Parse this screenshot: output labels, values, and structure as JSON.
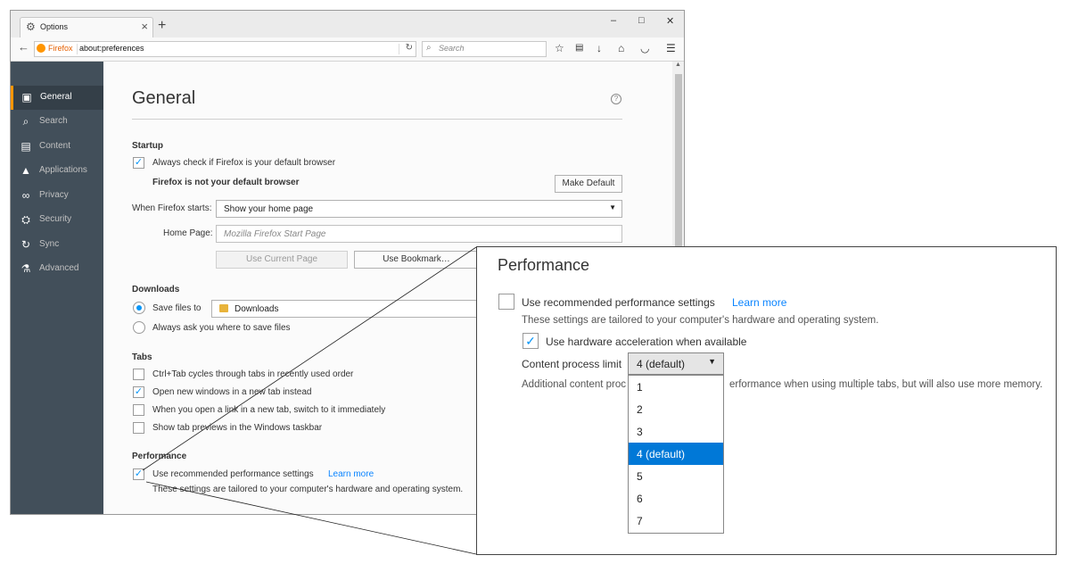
{
  "tab": {
    "title": "Options",
    "icon": "gear-icon"
  },
  "window_controls": [
    "–",
    "□",
    "✕"
  ],
  "navbar": {
    "brand": "Firefox",
    "url": "about:preferences",
    "search_placeholder": "Search"
  },
  "sidebar": {
    "items": [
      {
        "label": "General",
        "icon": "general-icon",
        "active": true
      },
      {
        "label": "Search",
        "icon": "search-icon",
        "active": false
      },
      {
        "label": "Content",
        "icon": "content-icon",
        "active": false
      },
      {
        "label": "Applications",
        "icon": "applications-icon",
        "active": false
      },
      {
        "label": "Privacy",
        "icon": "privacy-mask-icon",
        "active": false
      },
      {
        "label": "Security",
        "icon": "security-icon",
        "active": false
      },
      {
        "label": "Sync",
        "icon": "sync-icon",
        "active": false
      },
      {
        "label": "Advanced",
        "icon": "advanced-icon",
        "active": false
      }
    ]
  },
  "main": {
    "title": "General",
    "startup": {
      "heading": "Startup",
      "default_check_label": "Always check if Firefox is your default browser",
      "default_checked": true,
      "not_default_text": "Firefox is not your default browser",
      "make_default_button": "Make Default",
      "when_starts_label": "When Firefox starts:",
      "when_starts_value": "Show your home page",
      "home_page_label": "Home Page:",
      "home_page_placeholder": "Mozilla Firefox Start Page",
      "use_current_button": "Use Current Page",
      "use_bookmark_button": "Use Bookmark…"
    },
    "downloads": {
      "heading": "Downloads",
      "save_to_label": "Save files to",
      "save_to_folder": "Downloads",
      "always_ask_label": "Always ask you where to save files"
    },
    "tabs": {
      "heading": "Tabs",
      "options": [
        {
          "label": "Ctrl+Tab cycles through tabs in recently used order",
          "checked": false
        },
        {
          "label": "Open new windows in a new tab instead",
          "checked": true
        },
        {
          "label": "When you open a link in a new tab, switch to it immediately",
          "checked": false
        },
        {
          "label": "Show tab previews in the Windows taskbar",
          "checked": false
        }
      ]
    },
    "performance": {
      "heading": "Performance",
      "recommended_label": "Use recommended performance settings",
      "recommended_checked": true,
      "learn_more": "Learn more",
      "description": "These settings are tailored to your computer's hardware and operating system."
    }
  },
  "zoom_panel": {
    "title": "Performance",
    "recommended_label": "Use recommended performance settings",
    "recommended_checked": false,
    "learn_more": "Learn more",
    "description": "These settings are tailored to your computer's hardware and operating system.",
    "hw_accel_label": "Use hardware acceleration when available",
    "hw_accel_checked": true,
    "process_limit_label": "Content process limit",
    "process_limit_value": "4 (default)",
    "additional_text_left": "Additional content proc",
    "additional_text_right": "erformance when using multiple tabs, but will also use more memory.",
    "options": [
      "1",
      "2",
      "3",
      "4 (default)",
      "5",
      "6",
      "7"
    ],
    "highlighted_option": "4 (default)"
  }
}
